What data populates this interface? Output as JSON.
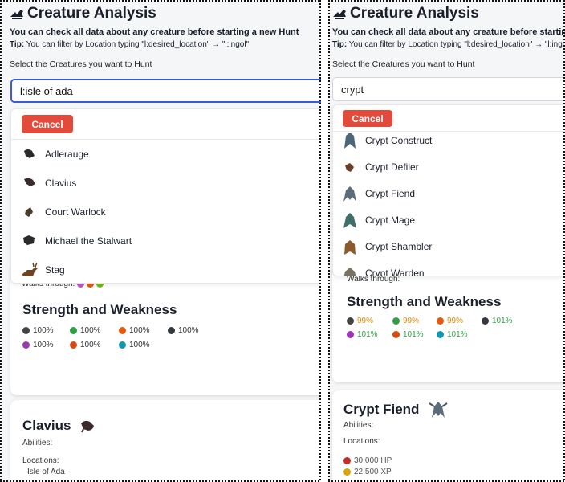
{
  "header": {
    "title": "Creature Analysis",
    "subtitle": "You can check all data about any creature before starting a new Hunt",
    "tip_label": "Tip:",
    "tip_text": "You can filter by Location typing \"l:desired_location\" → \"l:ingol\"",
    "field_label": "Select the Creatures you want to Hunt"
  },
  "left": {
    "search_value": "l:isle of ada",
    "cancel_label": "Cancel",
    "options": [
      "Adlerauge",
      "Clavius",
      "Court Warlock",
      "Michael the Stalwart",
      "Stag"
    ],
    "walks_label": "Walks through:",
    "sw_title": "Strength and Weakness",
    "stats": [
      "100%",
      "100%",
      "100%",
      "100%",
      "100%",
      "100%",
      "100%"
    ],
    "creature_name": "Clavius",
    "abilities_label": "Abilities:",
    "locations_label": "Locations:",
    "location_value": "Isle of Ada"
  },
  "right": {
    "search_value": "crypt",
    "cancel_label": "Cancel",
    "options": [
      "Crypt Construct",
      "Crypt Defiler",
      "Crypt Fiend",
      "Crypt Mage",
      "Crypt Shambler",
      "Crypt Warden"
    ],
    "walks_label": "Walks through:",
    "sw_title": "Strength and Weakness",
    "stats": [
      "99%",
      "99%",
      "99%",
      "101%",
      "101%",
      "101%",
      "101%"
    ],
    "creature_name": "Crypt Fiend",
    "abilities_label": "Abilities:",
    "locations_label": "Locations:",
    "hp": "30,000 HP",
    "xp": "22,500 XP"
  },
  "colors": {
    "accent_blue": "#3b5bdb",
    "cancel_red": "#e24a3b",
    "weak_orange": "#e08a00",
    "strong_green": "#2f9e44"
  }
}
